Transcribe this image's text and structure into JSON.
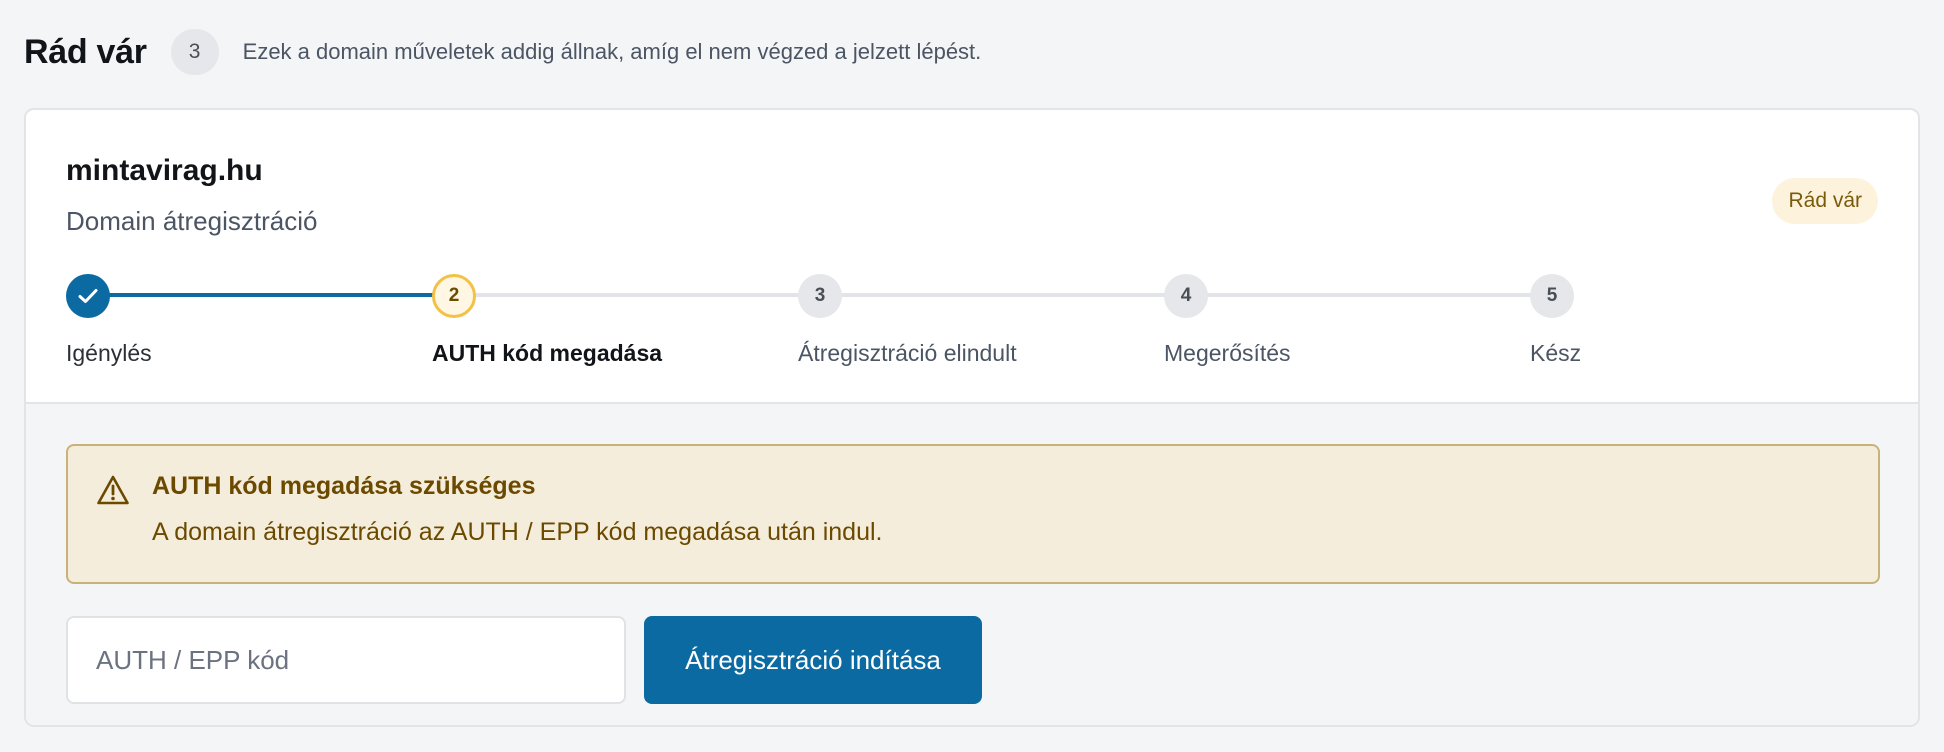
{
  "header": {
    "title": "Rád vár",
    "count": "3",
    "description": "Ezek a domain műveletek addig állnak, amíg el nem végzed a jelzett lépést."
  },
  "card": {
    "domain": "mintavirag.hu",
    "operation": "Domain átregisztráció",
    "status_label": "Rád vár",
    "steps": [
      {
        "number": "✓",
        "label": "Igénylés",
        "state": "done"
      },
      {
        "number": "2",
        "label": "AUTH kód megadása",
        "state": "current"
      },
      {
        "number": "3",
        "label": "Átregisztráció elindult",
        "state": "pending"
      },
      {
        "number": "4",
        "label": "Megerősítés",
        "state": "pending"
      },
      {
        "number": "5",
        "label": "Kész",
        "state": "pending"
      }
    ],
    "alert": {
      "icon": "warning-triangle-icon",
      "title": "AUTH kód megadása szükséges",
      "text": "A domain átregisztráció az AUTH / EPP kód megadása után indul."
    },
    "auth_input": {
      "placeholder": "AUTH / EPP kód",
      "value": ""
    },
    "start_button": "Átregisztráció indítása"
  },
  "colors": {
    "accent": "#0a6aa1",
    "current_step_ring": "#f2c146",
    "alert_background": "#f5eddb",
    "alert_text": "#6b4a00",
    "status_pill_background": "#fdf3dd"
  }
}
